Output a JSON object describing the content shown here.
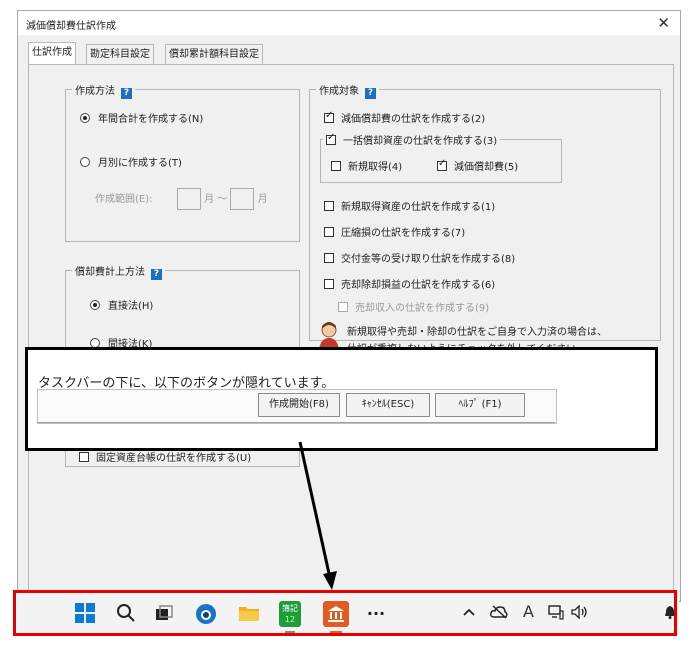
{
  "window": {
    "title": "減価償却費仕訳作成",
    "close_symbol": "✕"
  },
  "tabs": [
    "仕訳作成",
    "勘定科目設定",
    "償却累計額科目設定"
  ],
  "help_icon": "?",
  "creation_method": {
    "legend": "作成方法",
    "radio_annual": "年間合計を作成する(N)",
    "radio_monthly": "月別に作成する(T)",
    "range_label": "作成範囲(E):",
    "month1": "月",
    "tilde": "～",
    "month2": "月"
  },
  "calc_method": {
    "legend": "償却費計上方法",
    "radio_direct": "直接法(H)",
    "radio_indirect": "間接法(K)"
  },
  "target": {
    "legend": "作成対象",
    "depreciation": "減価償却費の仕訳を作成する(2)",
    "lump_sum": "一括償却資産の仕訳を作成する(3)",
    "new_acquisition": "新規取得(4)",
    "depreciation_expense": "減価償却費(5)",
    "new_asset": "新規取得資産の仕訳を作成する(1)",
    "compression": "圧縮損の仕訳を作成する(7)",
    "subsidy": "交付金等の受け取り仕訳を作成する(8)",
    "sale_gain": "売却除却損益の仕訳を作成する(6)",
    "sale_income": "売却収入の仕訳を作成する(9)",
    "note_line1": "新規取得や売却・除却の仕訳をご自身で入力済の場合は、",
    "note_line2": "仕訳が重複しないようにチェックを外してください。"
  },
  "overlay": {
    "text": "タスクバーの下に、以下のボタンが隠れています。",
    "btn_start": "作成開始(F8)",
    "btn_cancel": "ｷｬﾝｾﾙ(ESC)",
    "btn_help": "ﾍﾙﾌﾟ (F1)"
  },
  "hidden_row": "固定資産台帳の仕訳を作成する(U)",
  "taskbar": {
    "boki_app": "簿記",
    "boki_version": "12",
    "more": "···",
    "ime_char": "A"
  },
  "colors": {
    "accent": "#1e6fc0",
    "highlight": "#e60000",
    "overlay_border": "#000000"
  }
}
